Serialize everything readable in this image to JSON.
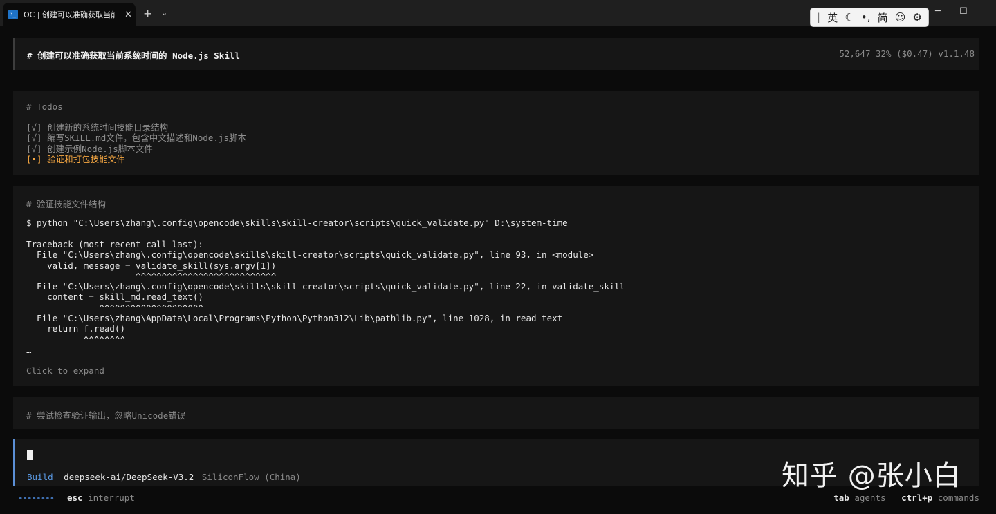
{
  "window": {
    "tab_icon": "powershell-icon",
    "tab_title": "OC | 创建可以准确获取当前系统",
    "tab_close": "✕",
    "new_tab": "+",
    "dropdown": "⌄",
    "minimize": "─",
    "maximize": "☐"
  },
  "ime": {
    "bar": "|",
    "lang": "英",
    "moon": "☾",
    "punct": "•,",
    "simplified": "简",
    "emoji": "☺",
    "settings": "⚙"
  },
  "header": {
    "title": "# 创建可以准确获取当前系统时间的 Node.js Skill",
    "stats": "52,647  32% ($0.47) v1.1.48"
  },
  "todos": {
    "title": "# Todos",
    "items": [
      {
        "text": "[√] 创建新的系统时间技能目录结构",
        "state": "done"
      },
      {
        "text": "[√] 编写SKILL.md文件，包含中文描述和Node.js脚本",
        "state": "done"
      },
      {
        "text": "[√] 创建示例Node.js脚本文件",
        "state": "done"
      },
      {
        "text": "[•] 验证和打包技能文件",
        "state": "in_progress"
      }
    ]
  },
  "validate": {
    "title": "# 验证技能文件结构",
    "command": "$ python \"C:\\Users\\zhang\\.config\\opencode\\skills\\skill-creator\\scripts\\quick_validate.py\" D:\\system-time",
    "traceback": [
      "Traceback (most recent call last):",
      "  File \"C:\\Users\\zhang\\.config\\opencode\\skills\\skill-creator\\scripts\\quick_validate.py\", line 93, in <module>",
      "    valid, message = validate_skill(sys.argv[1])",
      "                     ^^^^^^^^^^^^^^^^^^^^^^^^^^^",
      "  File \"C:\\Users\\zhang\\.config\\opencode\\skills\\skill-creator\\scripts\\quick_validate.py\", line 22, in validate_skill",
      "    content = skill_md.read_text()",
      "              ^^^^^^^^^^^^^^^^^^^^",
      "  File \"C:\\Users\\zhang\\AppData\\Local\\Programs\\Python\\Python312\\Lib\\pathlib.py\", line 1028, in read_text",
      "    return f.read()",
      "           ^^^^^^^^"
    ],
    "ellipsis": "…",
    "expand": "Click to expand"
  },
  "try": {
    "title": "# 尝试检查验证输出，忽略Unicode错误"
  },
  "input": {
    "mode": "Build",
    "model": "deepseek-ai/DeepSeek-V3.2",
    "provider": "SiliconFlow (China)"
  },
  "watermark": "知乎 @张小白",
  "footer": {
    "dots": "••••••••",
    "esc_key": "esc",
    "esc_desc": "interrupt",
    "tab_key": "tab",
    "tab_desc": "agents",
    "cmd_key": "ctrl+p",
    "cmd_desc": "commands"
  }
}
